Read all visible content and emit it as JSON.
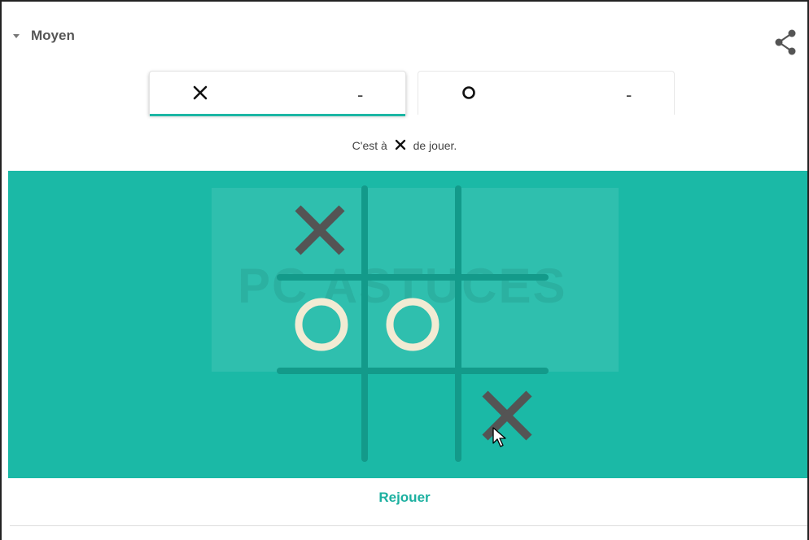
{
  "difficulty": {
    "label": "Moyen"
  },
  "scores": {
    "x": {
      "symbol": "X",
      "value": "-"
    },
    "o": {
      "symbol": "O",
      "value": "-"
    }
  },
  "turn": {
    "before": "C'est à",
    "after": "de jouer."
  },
  "watermark": {
    "text": "PC ASTUCES"
  },
  "board": {
    "cells": [
      "X",
      "",
      "",
      "O",
      "O",
      "",
      "",
      "",
      "X"
    ]
  },
  "actions": {
    "replay_label": "Rejouer"
  },
  "colors": {
    "board": "#1bb9a6",
    "accent": "#1cb6a4",
    "x_mark": "#545454",
    "o_mark": "#f2ebd3",
    "grid_line": "#139a8a"
  },
  "icons": {
    "share": "share-icon",
    "caret": "caret-down-icon",
    "cursor": "mouse-cursor-icon"
  }
}
